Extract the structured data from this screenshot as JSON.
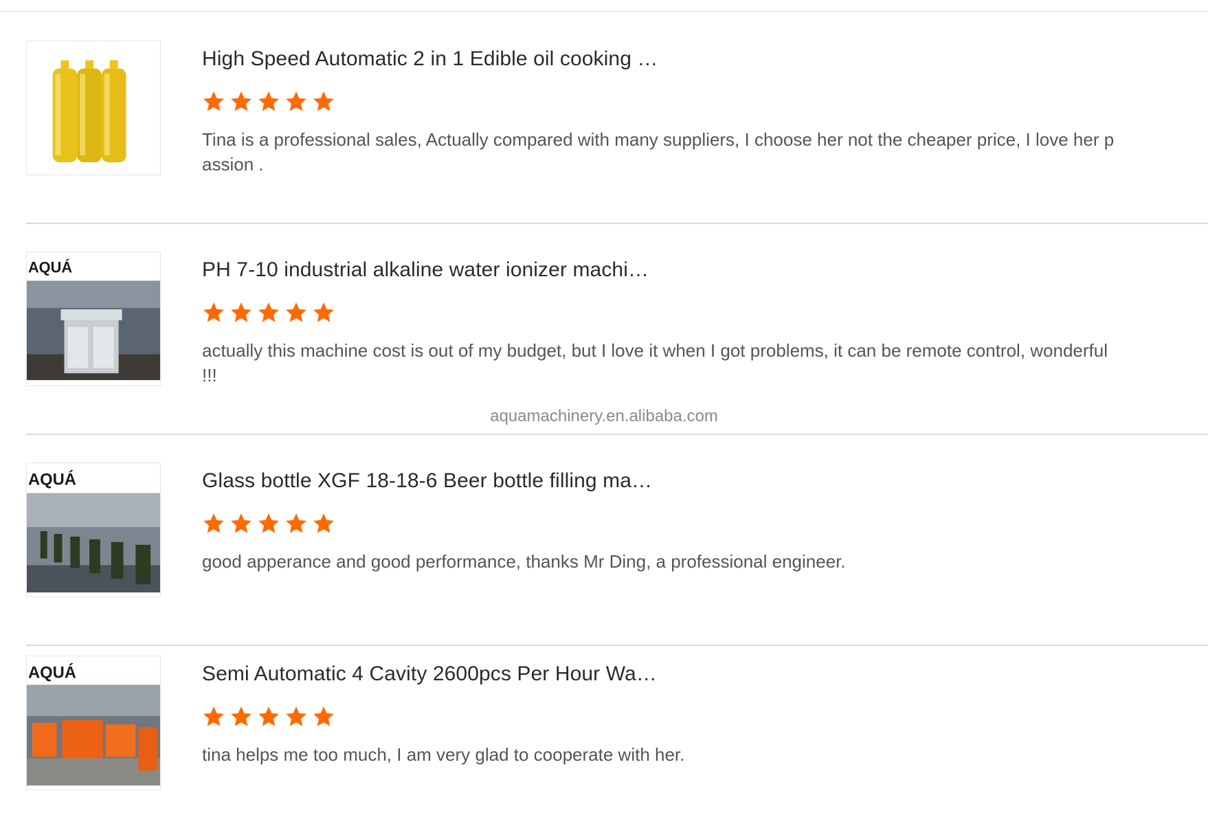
{
  "colors": {
    "star": "#ff6a00",
    "title": "#2b2b2b",
    "comment": "#555555",
    "divider": "#d9d9d9"
  },
  "watermark": "aquamachinery.en.alibaba.com",
  "reviews": [
    {
      "title": "High Speed Automatic 2 in 1 Edible oil cooking …",
      "rating": 5,
      "comment": "Tina is a professional sales, Actually compared with many suppliers, I choose her not the cheaper price, I love her passion .",
      "image": "oil-bottles-product-image"
    },
    {
      "title": "PH 7-10 industrial alkaline water ionizer machi…",
      "rating": 5,
      "comment": "actually this machine cost is out of my budget, but I love it when I got problems, it can be remote control, wonderful !!!",
      "image": "water-ionizer-product-image",
      "logo": "AQUÁ"
    },
    {
      "title": "Glass bottle XGF 18-18-6 Beer bottle filling ma…",
      "rating": 5,
      "comment": "good apperance and good performance, thanks  Mr Ding, a professional engineer.",
      "image": "beer-bottle-line-product-image",
      "logo": "AQUÁ"
    },
    {
      "title": "Semi Automatic 4 Cavity 2600pcs Per Hour Wa…",
      "rating": 5,
      "comment": "tina helps me too much, I am very glad to cooperate with her.",
      "image": "blow-molding-machine-product-image",
      "logo": "AQUÁ"
    }
  ]
}
